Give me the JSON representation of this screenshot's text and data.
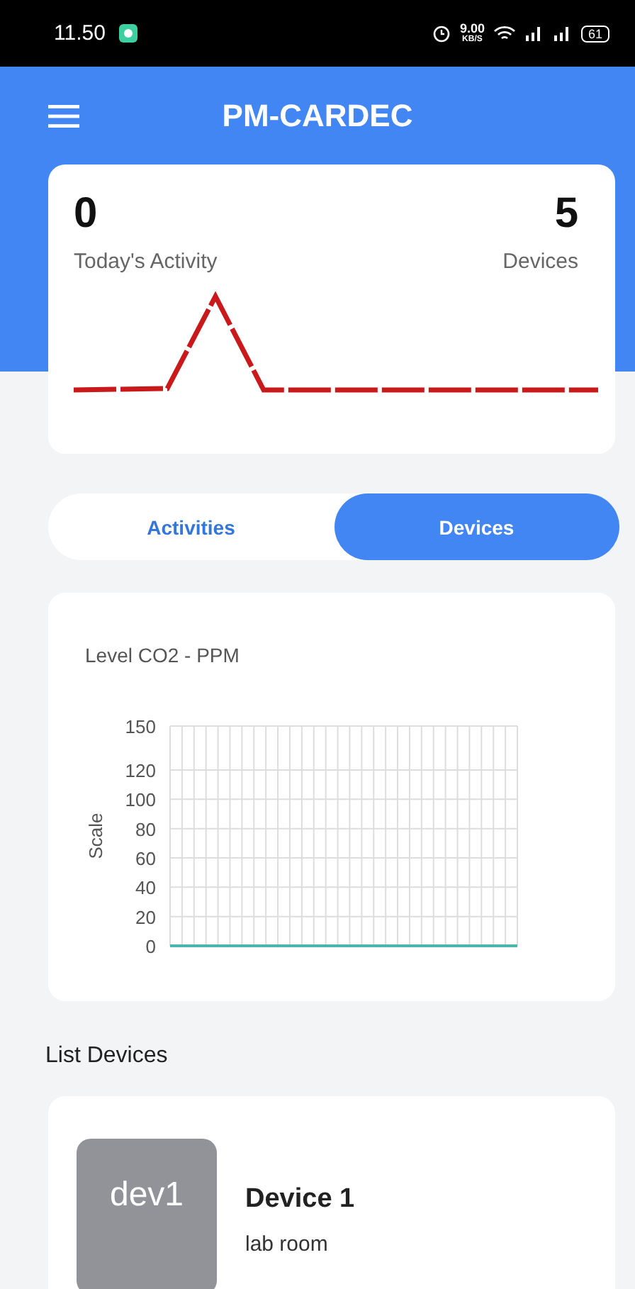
{
  "status_bar": {
    "time": "11.50",
    "speed": "9.00",
    "speed_unit": "KB/S",
    "battery": "61"
  },
  "app_bar": {
    "title": "PM-CARDEC"
  },
  "summary": {
    "activity_count": "0",
    "activity_label": "Today's Activity",
    "devices_count": "5",
    "devices_label": "Devices"
  },
  "tabs": [
    {
      "label": "Activities",
      "selected": false
    },
    {
      "label": "Devices",
      "selected": true
    }
  ],
  "co2_chart": {
    "chart_data": {
      "type": "line",
      "title": "Level CO2 - PPM",
      "ylabel": "Scale",
      "ylim": [
        0,
        150
      ],
      "yticks": [
        0,
        20,
        40,
        60,
        80,
        100,
        120,
        150
      ],
      "grid": true,
      "series": [
        {
          "color": "#4db6ac",
          "values": [
            0,
            0,
            0,
            0,
            0,
            0,
            0,
            0,
            0,
            0,
            0,
            0,
            0,
            0,
            0,
            0,
            0,
            0,
            0,
            0,
            0,
            0,
            0,
            0,
            0,
            0,
            0,
            0,
            0,
            0
          ]
        }
      ]
    }
  },
  "list_title": "List Devices",
  "devices": [
    {
      "avatar": "dev1",
      "name": "Device 1",
      "location": "lab room"
    }
  ]
}
